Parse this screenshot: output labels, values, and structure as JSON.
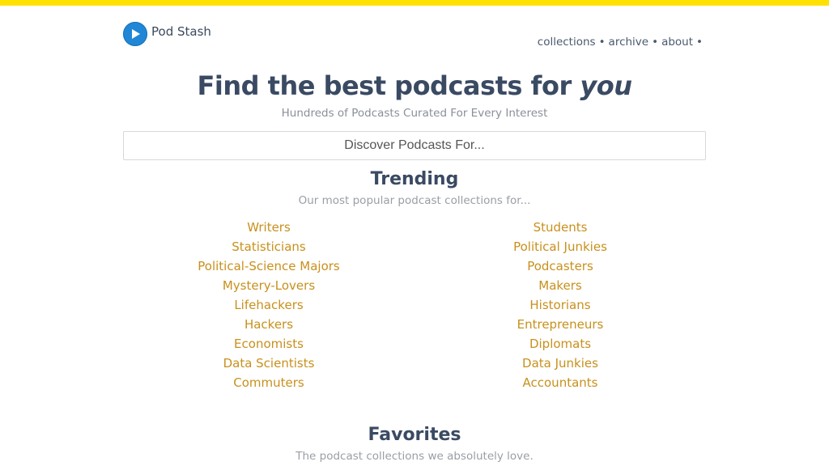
{
  "brand": {
    "name": "Pod Stash",
    "icon": "play-circle-icon",
    "accent": "#1f87d6"
  },
  "topbar_color": "#ffe100",
  "nav": {
    "items": [
      "collections",
      "archive",
      "about"
    ],
    "separator": "•"
  },
  "hero": {
    "title_main": "Find the best podcasts for ",
    "title_emph": "you",
    "subtitle": "Hundreds of Podcasts Curated For Every Interest"
  },
  "search": {
    "placeholder": "Discover Podcasts For..."
  },
  "trending": {
    "title": "Trending",
    "subtitle": "Our most popular podcast collections for...",
    "left": [
      "Writers",
      "Statisticians",
      "Political-Science Majors",
      "Mystery-Lovers",
      "Lifehackers",
      "Hackers",
      "Economists",
      "Data Scientists",
      "Commuters"
    ],
    "right": [
      "Students",
      "Political Junkies",
      "Podcasters",
      "Makers",
      "Historians",
      "Entrepreneurs",
      "Diplomats",
      "Data Junkies",
      "Accountants"
    ]
  },
  "favorites": {
    "title": "Favorites",
    "subtitle": "The podcast collections we absolutely love."
  },
  "colors": {
    "heading": "#3a4a63",
    "link": "#c8901c",
    "muted": "#9a9ea6"
  }
}
